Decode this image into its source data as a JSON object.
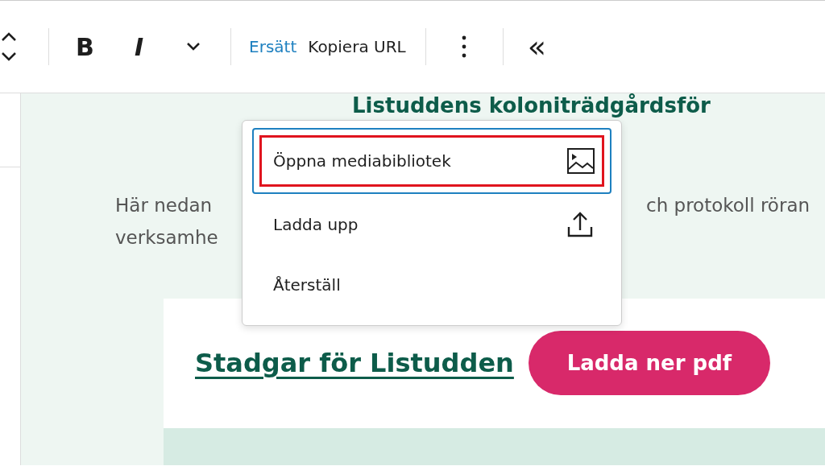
{
  "toolbar": {
    "items": [
      {
        "kind": "updown"
      },
      {
        "kind": "sep"
      },
      {
        "kind": "bold",
        "label": "B"
      },
      {
        "kind": "italic",
        "label": "I"
      },
      {
        "kind": "more"
      },
      {
        "kind": "sep"
      },
      {
        "kind": "text",
        "label": "Ersätt",
        "active": true
      },
      {
        "kind": "text",
        "label": "Kopiera URL",
        "active": false
      },
      {
        "kind": "sep"
      },
      {
        "kind": "kebab"
      },
      {
        "kind": "sep"
      },
      {
        "kind": "collapse",
        "label": "«"
      }
    ]
  },
  "content": {
    "heading": "Listuddens koloniträdgårdsför",
    "paragraph": {
      "line_1_start": "Här nedan",
      "line_1_end": "ch protokoll röran",
      "line_2_start": "verksamhe"
    },
    "card": {
      "link": "Stadgar för Listudden",
      "button": "Ladda ner pdf"
    }
  },
  "menu": {
    "items": [
      {
        "label": "Öppna mediabibliotek",
        "kind": "media",
        "focused": true,
        "annotated": true
      },
      {
        "label": "Ladda upp",
        "kind": "upload",
        "focused": false,
        "annotated": false
      },
      {
        "label": "Återställ",
        "kind": "plain",
        "focused": false,
        "annotated": false
      }
    ]
  }
}
